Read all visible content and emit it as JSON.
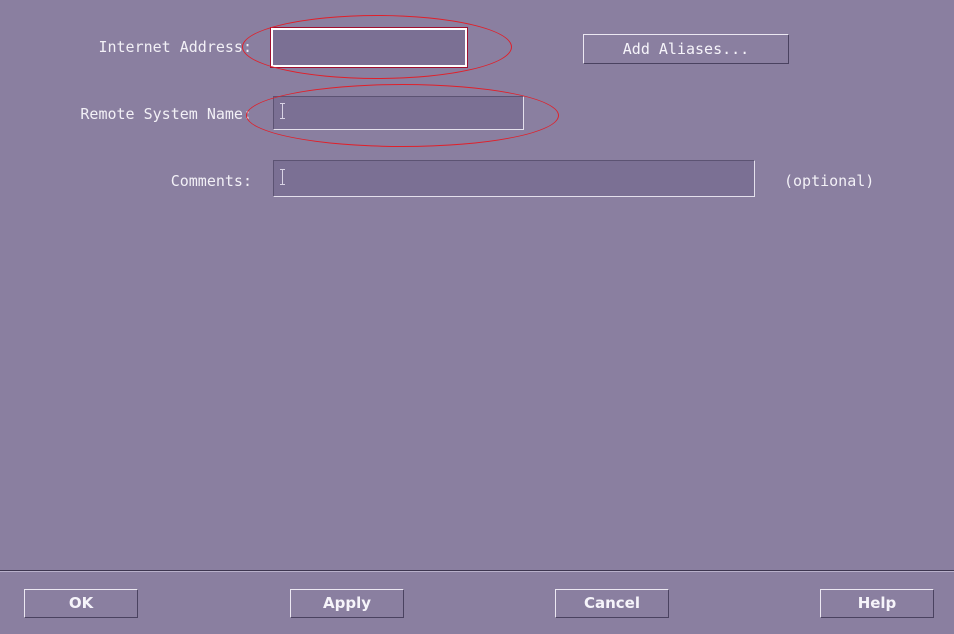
{
  "form": {
    "internet_address": {
      "label": "Internet Address:",
      "value": "",
      "placeholder": ""
    },
    "remote_system_name": {
      "label": "Remote System Name:",
      "value": "",
      "placeholder": ""
    },
    "comments": {
      "label": "Comments:",
      "value": "",
      "placeholder": "",
      "hint": "(optional)"
    },
    "add_aliases_label": "Add Aliases..."
  },
  "footer": {
    "ok_label": "OK",
    "apply_label": "Apply",
    "cancel_label": "Cancel",
    "help_label": "Help"
  },
  "colors": {
    "background": "#8a7fa0",
    "field_background": "#7b7094",
    "highlight_ellipse": "#e0202a"
  }
}
